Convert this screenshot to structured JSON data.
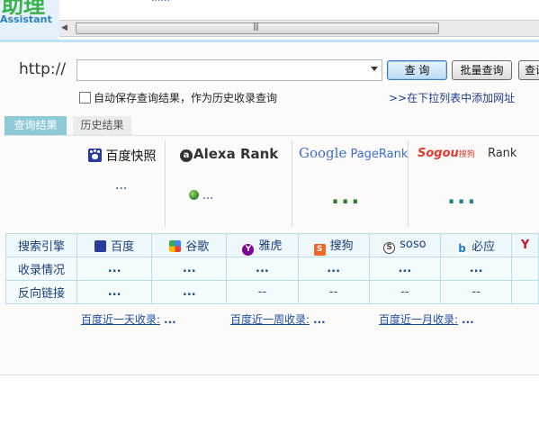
{
  "header": {
    "logo_big": "助理",
    "logo_small": "Assistant",
    "top_link": "······"
  },
  "query": {
    "protocol_label": "http://",
    "url_value": "",
    "query_button": "查 询",
    "batch_button": "批量查询",
    "more_button": "查询",
    "autosave_label": "自动保存查询结果，作为历史收录查询",
    "add_url_link": ">>在下拉列表中添加网址"
  },
  "tabs": [
    {
      "label": "查询结果",
      "active": true
    },
    {
      "label": "历史结果",
      "active": false
    }
  ],
  "ranks": {
    "baidu_snapshot": {
      "label": "百度快照",
      "value": "..."
    },
    "alexa": {
      "label_prefix": "Alexa",
      "label_suffix": " Rank",
      "value": "..."
    },
    "google_pr": {
      "label_google": "Google",
      "label_pr": " PageRank",
      "value": "..."
    },
    "sogou_rank": {
      "label_sogou": "Sogou",
      "label_cn": "搜狗",
      "label_rank": "Rank",
      "value": "..."
    }
  },
  "engine_table": {
    "row_headers": [
      "搜索引擎",
      "收录情况",
      "反向链接"
    ],
    "engines": [
      {
        "name": "百度",
        "icon": "baidu-icon",
        "indexed": "...",
        "backlinks": "..."
      },
      {
        "name": "谷歌",
        "icon": "google-icon",
        "indexed": "...",
        "backlinks": "..."
      },
      {
        "name": "雅虎",
        "icon": "yahoo-icon",
        "indexed": "...",
        "backlinks": "--"
      },
      {
        "name": "搜狗",
        "icon": "sogou-icon",
        "indexed": "...",
        "backlinks": "--"
      },
      {
        "name": "soso",
        "icon": "soso-icon",
        "indexed": "...",
        "backlinks": "--"
      },
      {
        "name": "必应",
        "icon": "bing-icon",
        "indexed": "...",
        "backlinks": "--"
      },
      {
        "name": "",
        "icon": "yahoo-partial-icon",
        "indexed": "",
        "backlinks": ""
      }
    ]
  },
  "recent": [
    {
      "label": "百度近一天收录:",
      "value": "..."
    },
    {
      "label": "百度近一周收录:",
      "value": "..."
    },
    {
      "label": "百度近一月收录:",
      "value": "..."
    }
  ],
  "colors": {
    "accent": "#8ecad6",
    "link": "#1c4fa0",
    "table_border": "#bcdde7"
  }
}
